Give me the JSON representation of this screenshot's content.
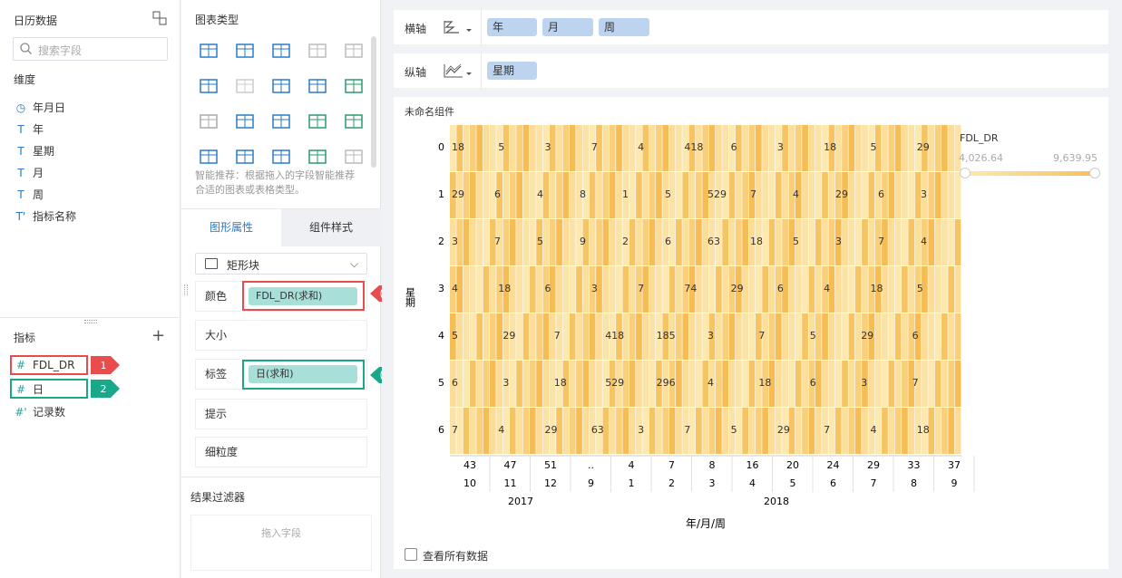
{
  "left": {
    "title": "日历数据",
    "search_placeholder": "搜索字段",
    "dim_title": "维度",
    "dims": [
      {
        "icon": "clock-icon",
        "label": "年月日"
      },
      {
        "icon": "text-icon",
        "label": "年"
      },
      {
        "icon": "text-icon",
        "label": "星期"
      },
      {
        "icon": "text-icon",
        "label": "月"
      },
      {
        "icon": "text-icon",
        "label": "周"
      },
      {
        "icon": "text-icon",
        "label": "指标名称"
      }
    ],
    "measure_title": "指标",
    "measures": [
      {
        "icon": "#",
        "label": "FDL_DR",
        "badge": "1",
        "badge_color": "#e84c4c"
      },
      {
        "icon": "#",
        "label": "日",
        "badge": "2",
        "badge_color": "#1aa88a"
      },
      {
        "icon": "#'",
        "label": "记录数"
      }
    ]
  },
  "mid": {
    "chart_type_title": "图表类型",
    "recommend_text": "智能推荐：根据拖入的字段智能推荐合适的图表或表格类型。",
    "tab_shape": "图形属性",
    "tab_style": "组件样式",
    "shape_select": "矩形块",
    "color_label": "颜色",
    "color_field": "FDL_DR(求和)",
    "size_label": "大小",
    "tag_label": "标签",
    "tag_field": "日(求和)",
    "tip_label": "提示",
    "granularity_label": "细粒度",
    "filter_title": "结果过滤器",
    "filter_drop": "拖入字段",
    "callout1": "1",
    "callout2": "2"
  },
  "right": {
    "xaxis_label": "横轴",
    "xaxis_fields": [
      "年",
      "月",
      "周"
    ],
    "yaxis_label": "纵轴",
    "yaxis_fields": [
      "星期"
    ],
    "component_title": "未命名组件",
    "view_all": "查看所有数据",
    "legend_title": "FDL_DR",
    "legend_min": "4,026.64",
    "legend_max": "9,639.95"
  },
  "chart_data": {
    "type": "heatmap",
    "title": "未命名组件",
    "ylabel": "星期",
    "xlabel": "年/月/周",
    "y_categories": [
      "0",
      "1",
      "2",
      "3",
      "4",
      "5",
      "6"
    ],
    "years": [
      "2017",
      "2018"
    ],
    "weeks_labels": [
      "43",
      "47",
      "51",
      "..",
      "4",
      "7",
      "8",
      "16",
      "20",
      "24",
      "29",
      "33",
      "37"
    ],
    "month_labels": [
      "10",
      "11",
      "12",
      "9",
      "1",
      "2",
      "3",
      "4",
      "5",
      "6",
      "7",
      "8",
      "9"
    ],
    "cell_labels": [
      [
        "18",
        "5",
        "3",
        "7",
        "4",
        "418",
        "6",
        "3",
        "18",
        "5",
        "29"
      ],
      [
        "29",
        "6",
        "4",
        "8",
        "1",
        "5",
        "529",
        "7",
        "4",
        "29",
        "6",
        "3"
      ],
      [
        "3",
        "7",
        "5",
        "9",
        "2",
        "6",
        "63",
        "18",
        "5",
        "3",
        "7",
        "4"
      ],
      [
        "4",
        "18",
        "6",
        "3",
        "7",
        "74",
        "29",
        "6",
        "4",
        "18",
        "5"
      ],
      [
        "5",
        "29",
        "7",
        "418",
        "185",
        "3",
        "7",
        "5",
        "29",
        "6"
      ],
      [
        "6",
        "3",
        "18",
        "529",
        "296",
        "4",
        "18",
        "6",
        "3",
        "7"
      ],
      [
        "7",
        "4",
        "29",
        "63",
        "3",
        "7",
        "5",
        "29",
        "7",
        "4",
        "18"
      ]
    ],
    "color_range": [
      4026.64,
      9639.95
    ]
  }
}
